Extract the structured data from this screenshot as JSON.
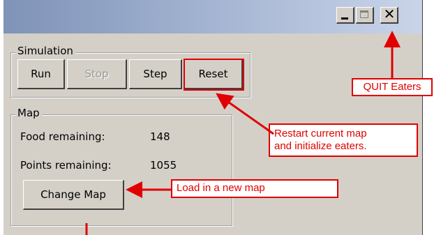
{
  "window": {
    "controls": {
      "minimize_icon": "minimize-icon",
      "maximize_icon": "maximize-icon",
      "close_glyph": "✕"
    }
  },
  "simulation": {
    "group_label": "Simulation",
    "buttons": {
      "run": "Run",
      "stop": "Stop",
      "step": "Step",
      "reset": "Reset"
    },
    "stop_disabled": true
  },
  "map": {
    "group_label": "Map",
    "food_label": "Food remaining:",
    "food_value": "148",
    "points_label": "Points remaining:",
    "points_value": "1055",
    "change_map_button": "Change Map"
  },
  "annotations": {
    "quit": "QUIT Eaters",
    "reset_line1": "Restart current map",
    "reset_line2": "and initialize eaters.",
    "change_map": "Load in a new map",
    "color": "#e00000"
  }
}
